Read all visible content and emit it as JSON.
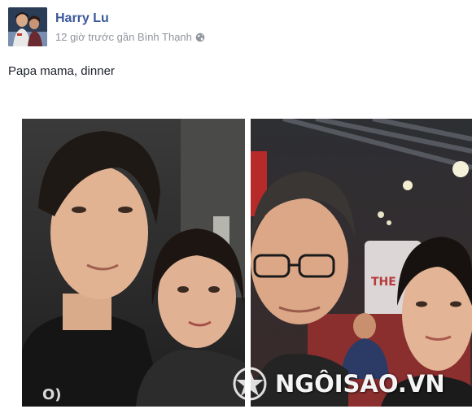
{
  "post": {
    "author": "Harry Lu",
    "meta": "12 giờ trước gần Bình Thạnh",
    "privacy_icon": "globe-icon",
    "status_text": "Papa mama, dinner"
  },
  "photos": [
    {
      "subject": "selfie-left"
    },
    {
      "subject": "selfie-right"
    }
  ],
  "watermark": {
    "text": "NGÔISAO.VN"
  },
  "colors": {
    "author_link": "#3b5998",
    "meta_text": "#90949c",
    "body_text": "#1d2129"
  }
}
